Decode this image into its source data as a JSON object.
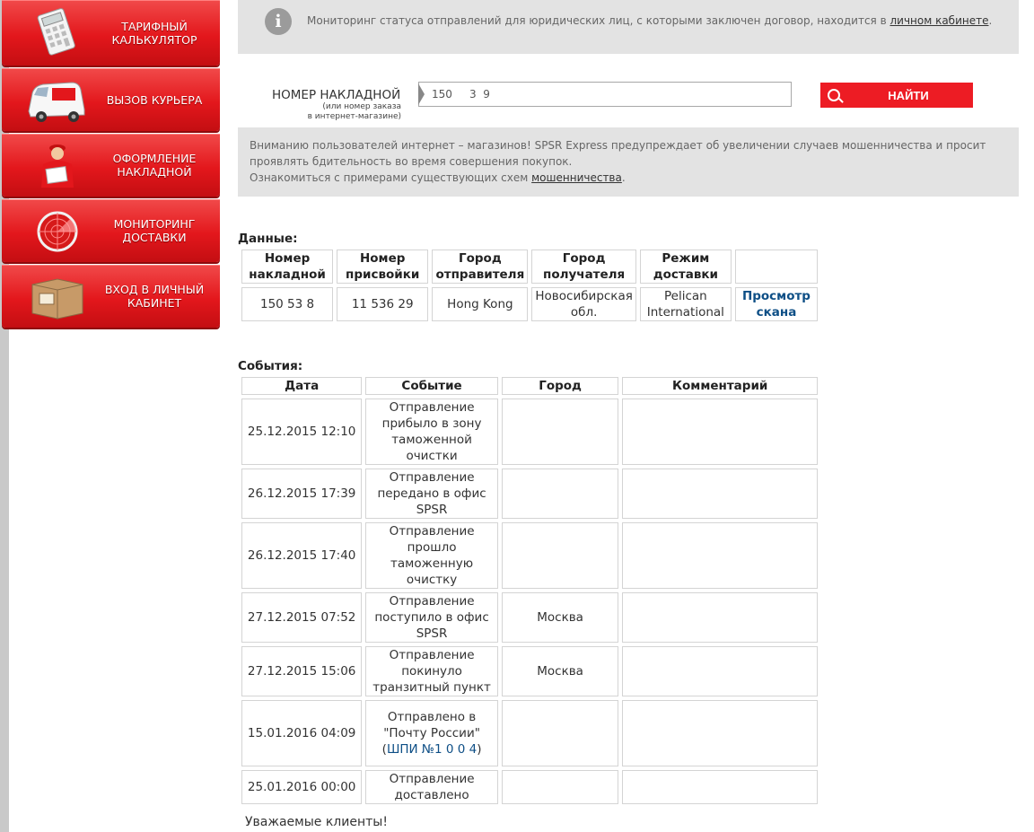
{
  "sidebar": {
    "items": [
      {
        "label": "ТАРИФНЫЙ КАЛЬКУЛЯТОР",
        "icon": "calculator-icon"
      },
      {
        "label": "ВЫЗОВ КУРЬЕРА",
        "icon": "courier-van-icon"
      },
      {
        "label": "ОФОРМЛЕНИЕ НАКЛАДНОЙ",
        "icon": "courier-person-icon"
      },
      {
        "label": "МОНИТОРИНГ ДОСТАВКИ",
        "icon": "radar-icon"
      },
      {
        "label": "ВХОД В ЛИЧНЫЙ КАБИНЕТ",
        "icon": "box-login-icon"
      }
    ]
  },
  "info": {
    "text": "Мониторинг статуса отправлений для юридических лиц, с которыми заключен договор, находится в ",
    "link": "личном кабинете",
    "tail": "."
  },
  "search": {
    "label": "НОМЕР НАКЛАДНОЙ",
    "sublabel_1": "(или номер заказа",
    "sublabel_2": "в интернет-магазине)",
    "value": "150     3  9",
    "button": "НАЙТИ"
  },
  "warning": {
    "line1": "Вниманию пользователей интернет – магазинов! SPSR Express предупреждает об увеличении случаев мошенничества и просит проявлять бдительность во время совершения покупок.",
    "line2_prefix": "Ознакомиться с примерами существующих схем ",
    "line2_link": "мошенничества",
    "line2_suffix": "."
  },
  "data_section": {
    "title": "Данные:",
    "headers": [
      "Номер накладной",
      "Номер присвойки",
      "Город отправителя",
      "Город получателя",
      "Режим доставки",
      ""
    ],
    "row": [
      "150      53  8",
      "11  536     29",
      "Hong Kong",
      "Новосибирская обл.",
      "Pelican International",
      "Просмотр скана"
    ]
  },
  "events_section": {
    "title": "События:",
    "headers": [
      "Дата",
      "Событие",
      "Город",
      "Комментарий"
    ],
    "rows": [
      {
        "date": "25.12.2015 12:10",
        "event": "Отправление прибыло в зону таможенной очистки",
        "city": "",
        "comment": ""
      },
      {
        "date": "26.12.2015 17:39",
        "event": "Отправление передано в офис SPSR",
        "city": "",
        "comment": ""
      },
      {
        "date": "26.12.2015 17:40",
        "event": "Отправление прошло таможенную очистку",
        "city": "",
        "comment": ""
      },
      {
        "date": "27.12.2015 07:52",
        "event": "Отправление поступило в офис SPSR",
        "city": "Москва",
        "comment": ""
      },
      {
        "date": "27.12.2015 15:06",
        "event": "Отправление покинуло транзитный пункт",
        "city": "Москва",
        "comment": ""
      },
      {
        "date": "15.01.2016 04:09",
        "event": "Отправлено в \"Почту России\" (",
        "event_link": "ШПИ №1  0       0   4",
        "event_tail": ")",
        "city": "",
        "comment": ""
      },
      {
        "date": "25.01.2016 00:00",
        "event": "Отправление доставлено",
        "city": "",
        "comment": ""
      }
    ]
  },
  "footer": {
    "text": "Уважаемые клиенты!"
  }
}
